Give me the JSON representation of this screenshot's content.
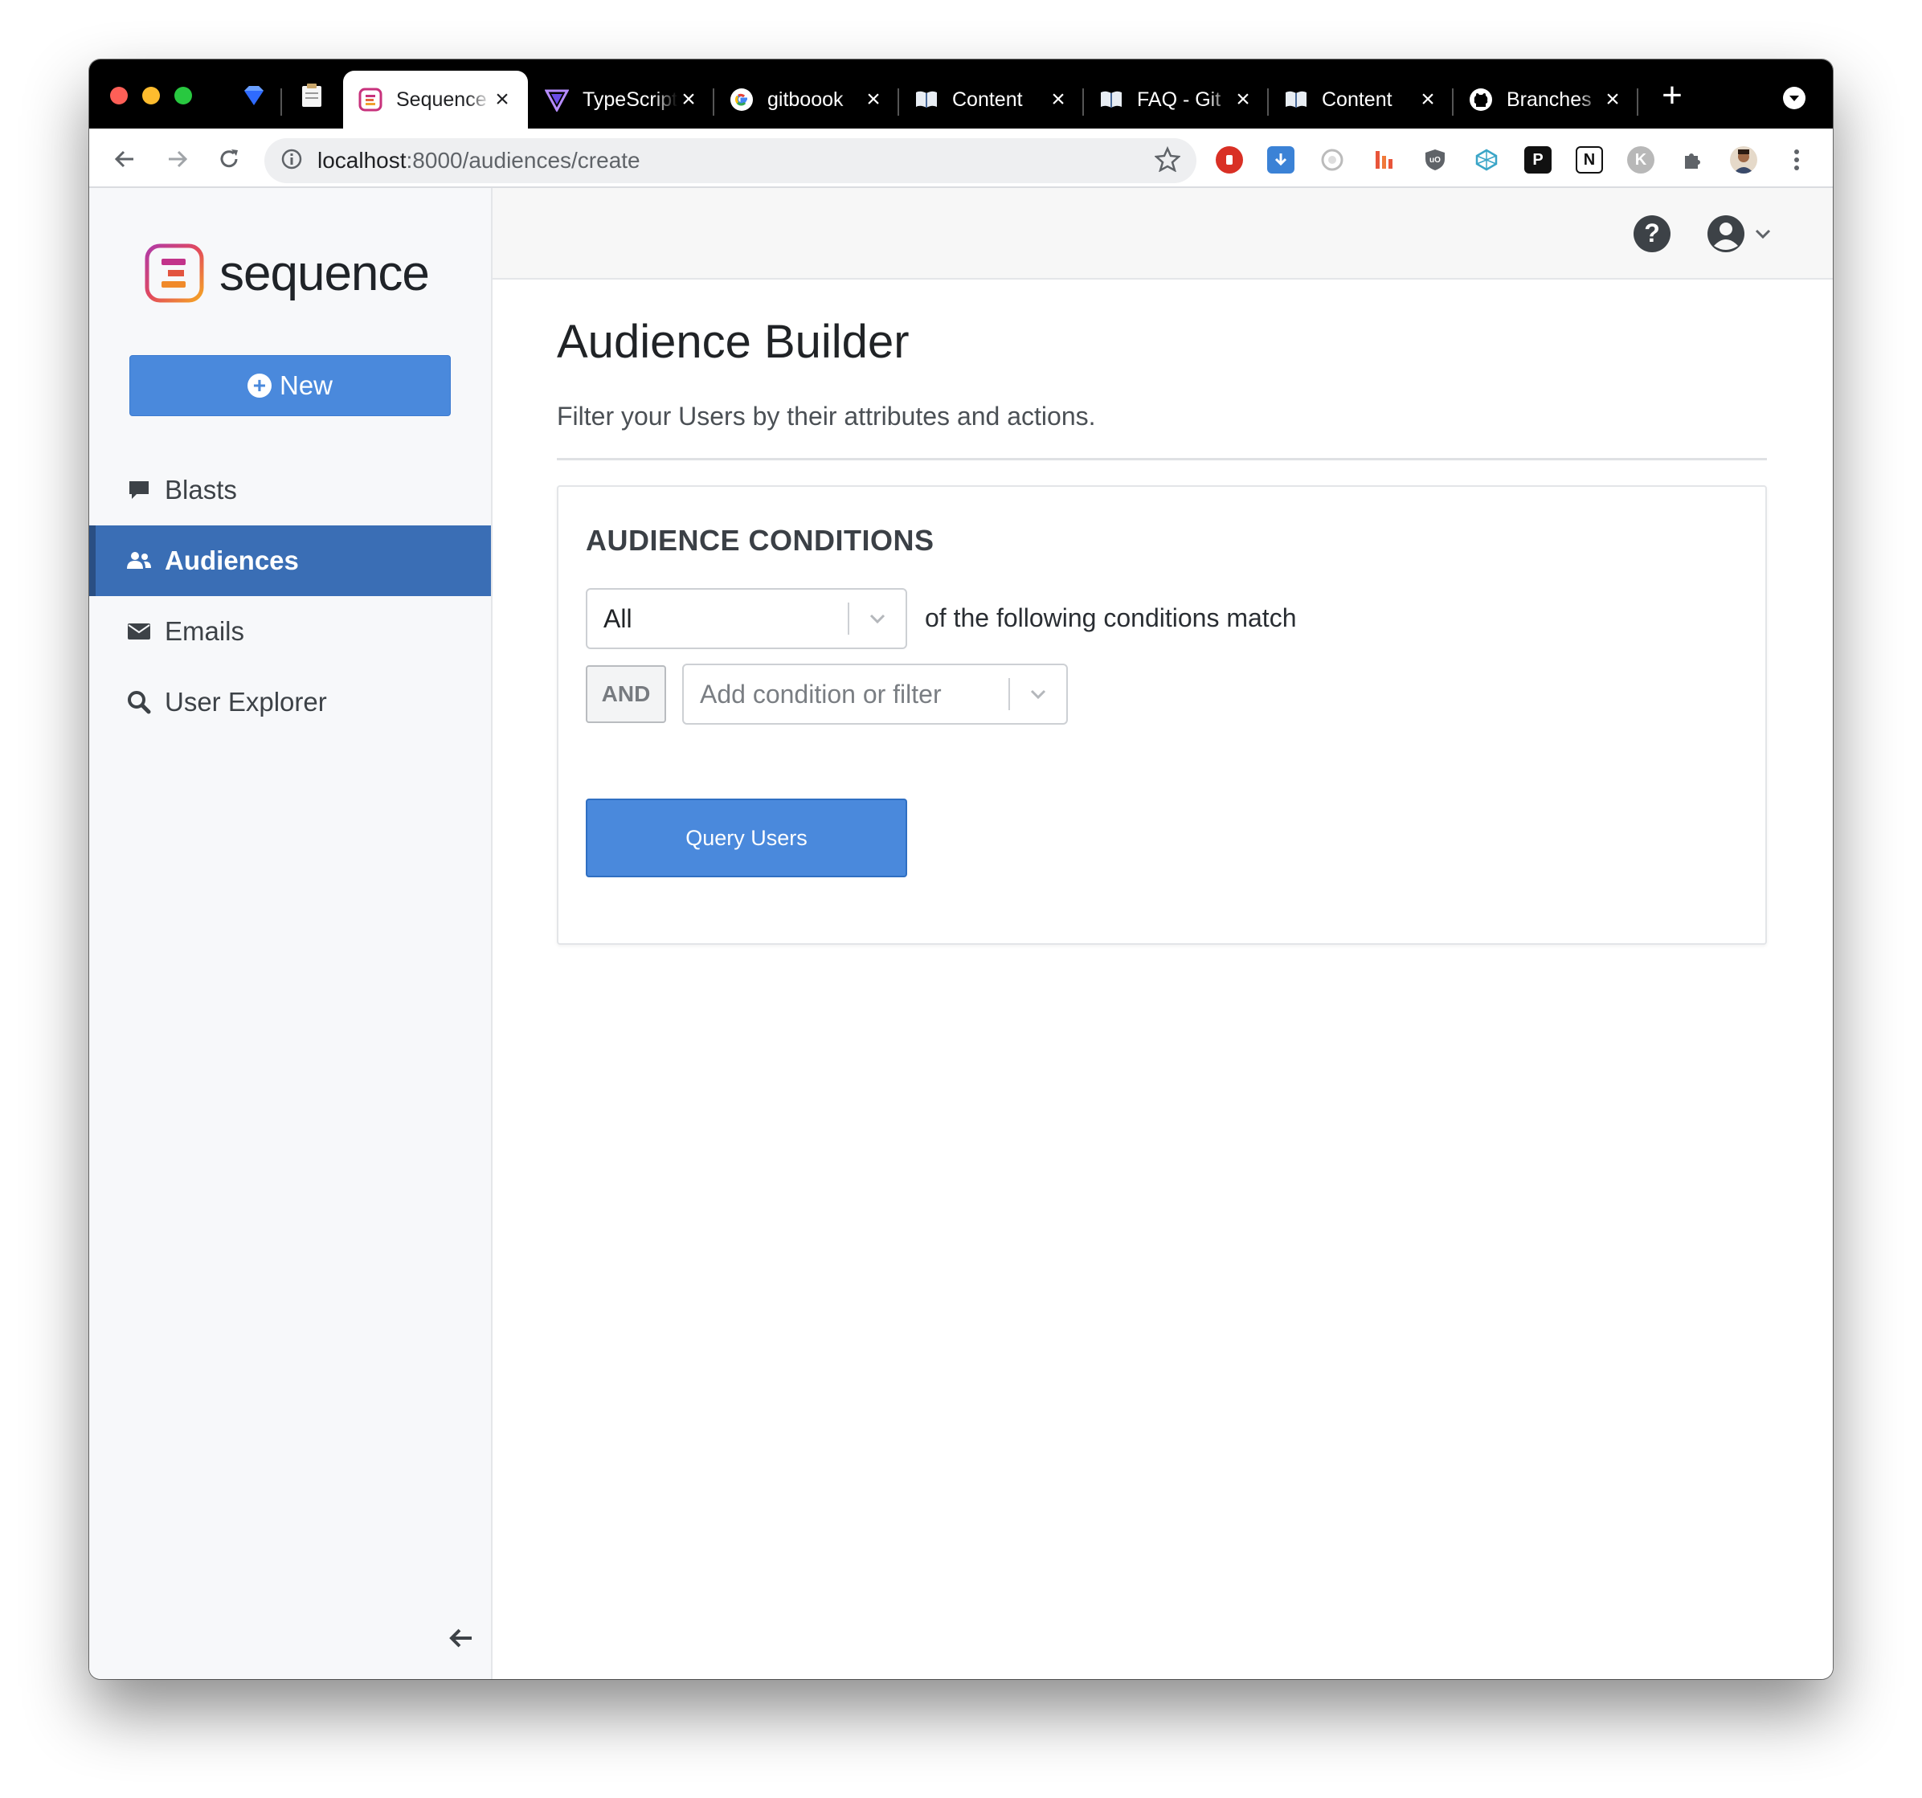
{
  "browser": {
    "tabs": [
      {
        "title": "Sequence",
        "active": true,
        "icon": "sequence-favicon"
      },
      {
        "title": "TypeScript",
        "active": false,
        "icon": "typescript-favicon"
      },
      {
        "title": "gitboook",
        "active": false,
        "icon": "google-favicon"
      },
      {
        "title": "Content",
        "active": false,
        "icon": "book-favicon"
      },
      {
        "title": "FAQ - Git",
        "active": false,
        "icon": "book-favicon"
      },
      {
        "title": "Content",
        "active": false,
        "icon": "book-favicon"
      },
      {
        "title": "Branches",
        "active": false,
        "icon": "github-favicon"
      }
    ],
    "url_host": "localhost",
    "url_rest": ":8000/audiences/create"
  },
  "sidebar": {
    "logo_text": "sequence",
    "new_button_label": "New",
    "items": [
      {
        "label": "Blasts",
        "icon": "comment-icon",
        "active": false
      },
      {
        "label": "Audiences",
        "icon": "users-icon",
        "active": true
      },
      {
        "label": "Emails",
        "icon": "envelope-icon",
        "active": false
      },
      {
        "label": "User Explorer",
        "icon": "search-icon",
        "active": false
      }
    ]
  },
  "page": {
    "title": "Audience Builder",
    "subtitle": "Filter your Users by their attributes and actions."
  },
  "conditions": {
    "heading": "AUDIENCE CONDITIONS",
    "match_value": "All",
    "match_text": "of the following conditions match",
    "and_label": "AND",
    "condition_placeholder": "Add condition or filter",
    "query_button": "Query Users"
  },
  "colors": {
    "primary": "#4a89dc",
    "sidebar_active": "#3a6eb5"
  }
}
